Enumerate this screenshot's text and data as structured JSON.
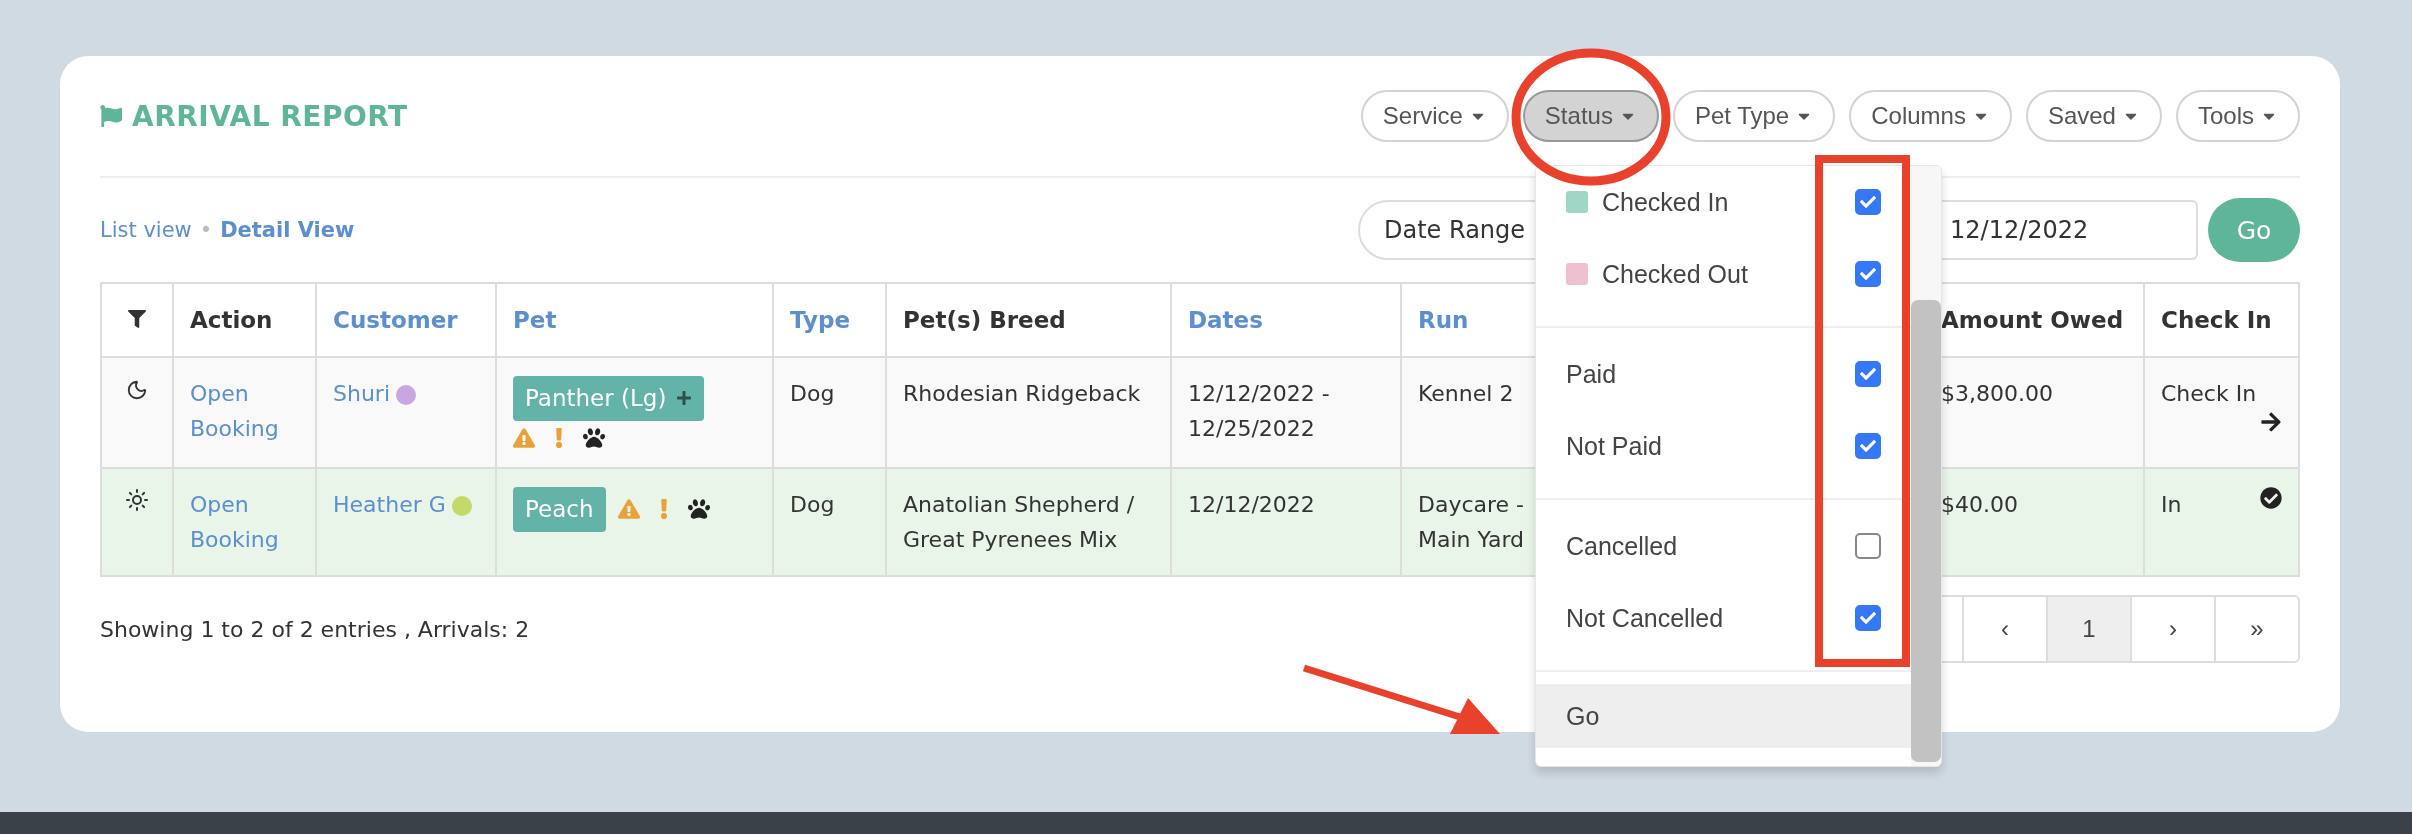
{
  "report": {
    "title": "ARRIVAL REPORT"
  },
  "filters": [
    {
      "label": "Service",
      "selected": false
    },
    {
      "label": "Status",
      "selected": true
    },
    {
      "label": "Pet Type",
      "selected": false
    },
    {
      "label": "Columns",
      "selected": false
    },
    {
      "label": "Saved",
      "selected": false
    },
    {
      "label": "Tools",
      "selected": false
    }
  ],
  "views": [
    {
      "label": "List view",
      "selected": false
    },
    {
      "label": "Detail View",
      "selected": true
    }
  ],
  "view_separator": "•",
  "date_range": {
    "label": "Date Range",
    "end_date": "12/12/2022",
    "go": "Go"
  },
  "table": {
    "columns": [
      {
        "label": "Action",
        "sortable": false
      },
      {
        "label": "Customer",
        "sortable": true
      },
      {
        "label": "Pet",
        "sortable": true
      },
      {
        "label": "Type",
        "sortable": true
      },
      {
        "label": "Pet(s) Breed",
        "sortable": false
      },
      {
        "label": "Dates",
        "sortable": true
      },
      {
        "label": "Run",
        "sortable": true
      },
      {
        "label": "Amount Owed",
        "sortable": false
      },
      {
        "label": "Check In",
        "sortable": false
      }
    ],
    "rows": [
      {
        "kind": "overnight",
        "action": "Open Booking",
        "customer": "Shuri",
        "customer_dot": {
          "color": "#c9a6e2"
        },
        "pet": "Panther (Lg)",
        "pet_addable": true,
        "type": "Dog",
        "breed": "Rhodesian Ridgeback",
        "dates": "12/12/2022 - 12/25/2022",
        "run": "Kennel 2",
        "amount_owed": "$3,800.00",
        "check_in": {
          "label": "Check In",
          "done": false
        }
      },
      {
        "kind": "daycare",
        "action": "Open Booking",
        "customer": "Heather G",
        "customer_dot": {
          "color": "#c3da6a"
        },
        "pet": "Peach",
        "pet_addable": false,
        "type": "Dog",
        "breed": "Anatolian Shepherd / Great Pyrenees Mix",
        "dates": "12/12/2022",
        "run": "Daycare - Main Yard",
        "amount_owed": "$40.00",
        "check_in": {
          "label": "In",
          "done": true
        }
      }
    ]
  },
  "summary": "Showing 1 to 2 of 2 entries , Arrivals: 2",
  "pagination": [
    {
      "label": "‹",
      "selected": false
    },
    {
      "label": "1",
      "selected": true
    },
    {
      "label": "›",
      "selected": false
    },
    {
      "label": "»",
      "selected": false
    }
  ],
  "status_menu": {
    "groups": [
      [
        {
          "label": "Checked In",
          "color": "#9fd6c6",
          "checked": true
        },
        {
          "label": "Checked Out",
          "color": "#efc0cf",
          "checked": true
        }
      ],
      [
        {
          "label": "Paid",
          "checked": true
        },
        {
          "label": "Not Paid",
          "checked": true
        }
      ],
      [
        {
          "label": "Cancelled",
          "checked": false
        },
        {
          "label": "Not Cancelled",
          "checked": true
        }
      ]
    ],
    "go": "Go"
  }
}
